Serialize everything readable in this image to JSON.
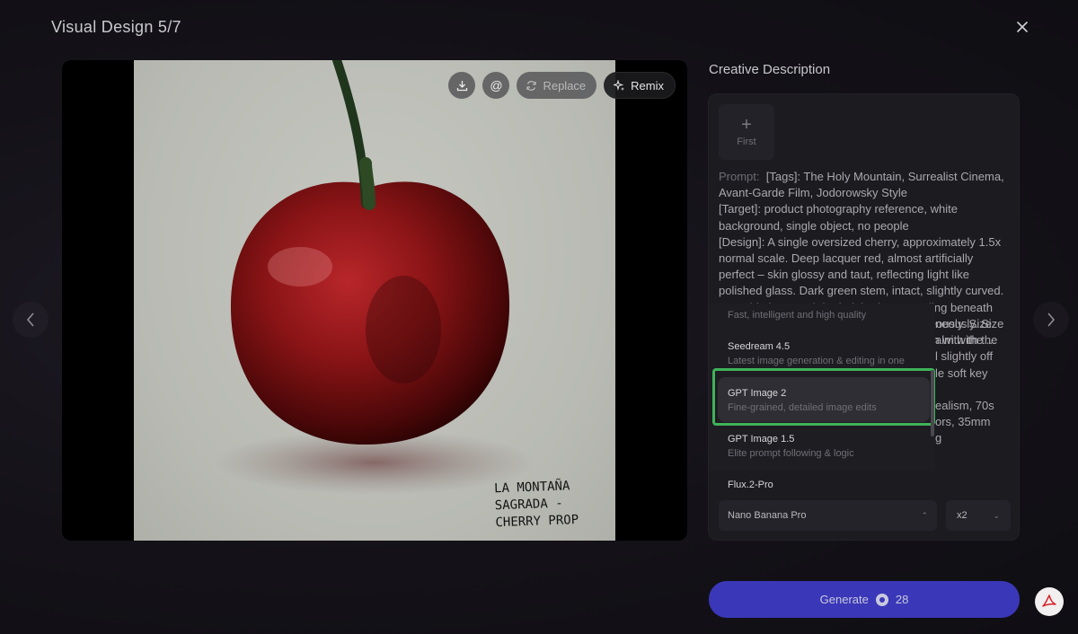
{
  "header": {
    "title": "Visual Design 5/7"
  },
  "icons": {
    "close": "close-icon",
    "prev": "chevron-left-icon",
    "next": "chevron-right-icon",
    "download": "download-icon",
    "mention": "at-icon",
    "replace": "refresh-icon",
    "remix": "sparkle-icon",
    "credit": "credit-icon",
    "acrobat": "acrobat-icon"
  },
  "image_toolbar": {
    "replace_label": "Replace",
    "remix_label": "Remix"
  },
  "image": {
    "note_lines": [
      "LA MONTAÑA",
      "SAGRADA -",
      "CHERRY PROP"
    ]
  },
  "panel": {
    "title": "Creative Description",
    "first_frame_label": "First",
    "prompt_label": "Prompt:",
    "prompt_text": "[Tags]: The Holy Mountain, Surrealist Cinema, Avant-Garde Film, Jodorowsky Style\n[Target]: product photography reference, white background, single object, no people\n[Design]: A single oversized cherry, approximately 1.5x normal scale. Deep lacquer red, almost artificially perfect – skin glossy and taut, reflecting light like polished glass. Dark green stem, intact, slightly curved.\nOne side has a subtle dark bruise spreading beneath the skin, as if rotting from inside simultaneously. Size reference: fits comfortably in an open palm with the ...",
    "prompt_visible_fragments": [
      "neously. Size",
      "alm with the",
      "l slightly off",
      "le soft key",
      "ealism, 70s",
      "ors, 35mm",
      "g"
    ]
  },
  "model_dropdown": {
    "partial_top_desc": "Fast, intelligent and high quality",
    "items": [
      {
        "name": "Seedream 4.5",
        "desc": "Latest image generation & editing in one"
      },
      {
        "name": "GPT Image 2",
        "desc": "Fine-grained, detailed image edits",
        "selected": true
      },
      {
        "name": "GPT Image 1.5",
        "desc": "Elite prompt following & logic"
      },
      {
        "name": "Flux.2-Pro",
        "desc": ""
      }
    ]
  },
  "controls": {
    "model_value": "Nano Banana Pro",
    "count_value": "x2"
  },
  "generate": {
    "label": "Generate",
    "credits": "28"
  },
  "colors": {
    "accent": "#3a37b8",
    "highlight": "#3fb25a",
    "cherry": "#8a1416"
  }
}
